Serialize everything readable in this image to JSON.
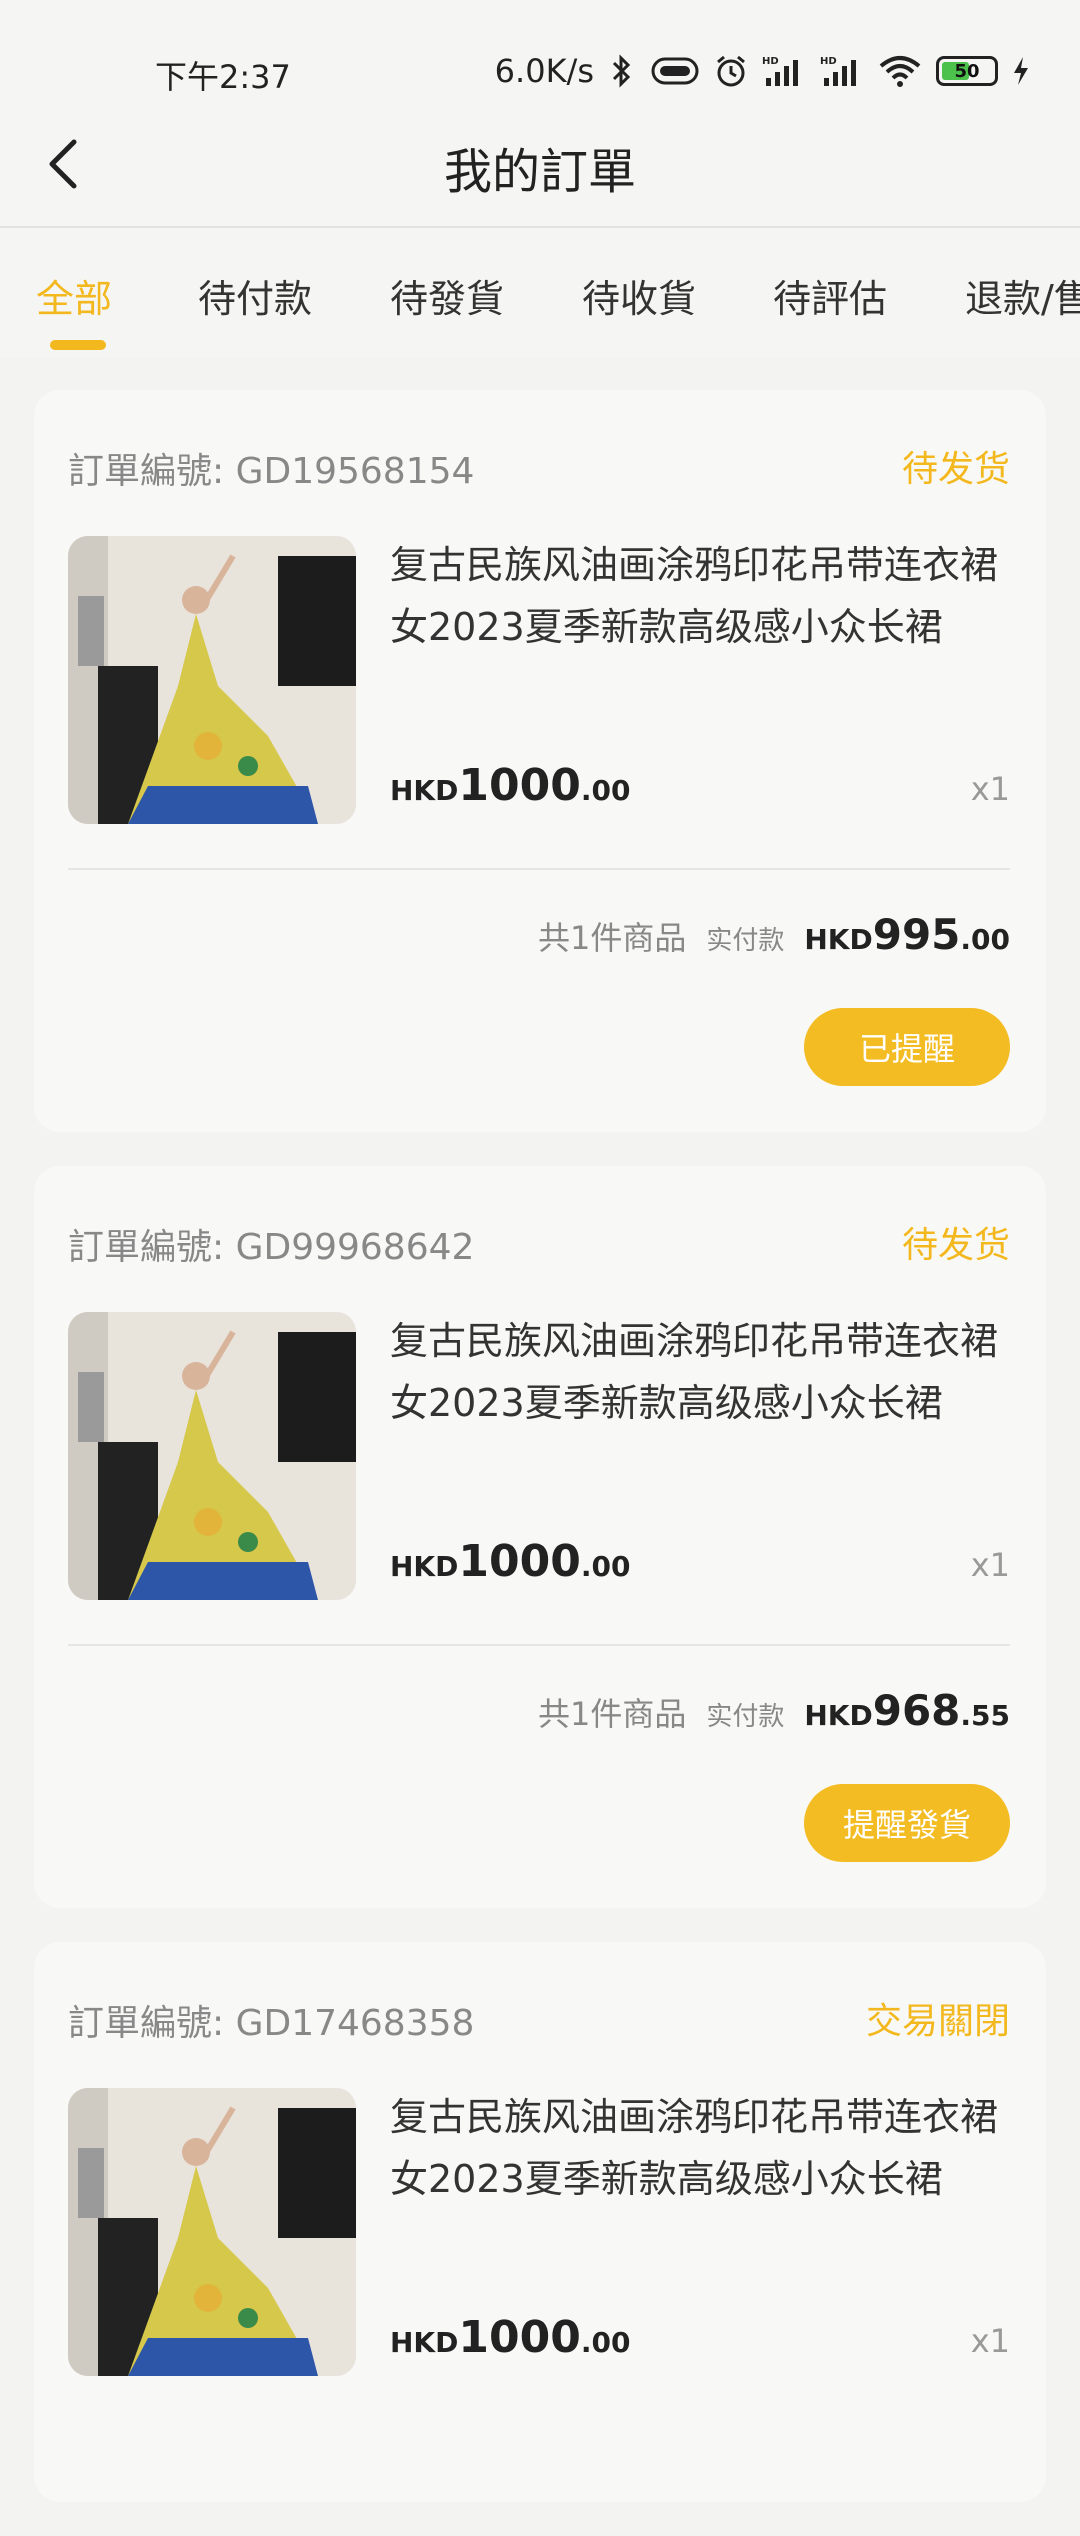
{
  "status_bar": {
    "time": "下午2:37",
    "net_speed": "6.0K/s",
    "battery": "50"
  },
  "header": {
    "title": "我的訂單"
  },
  "tabs": [
    {
      "label": "全部",
      "active": true
    },
    {
      "label": "待付款",
      "active": false
    },
    {
      "label": "待發貨",
      "active": false
    },
    {
      "label": "待收貨",
      "active": false
    },
    {
      "label": "待評估",
      "active": false
    },
    {
      "label": "退款/售",
      "active": false
    }
  ],
  "colors": {
    "accent": "#f3b81e",
    "button": "#f3bc22"
  },
  "orders": [
    {
      "order_no_label": "訂單編號:  GD19568154",
      "status": "待发货",
      "product_title": "复古民族风油画涂鸦印花吊带连衣裙女2023夏季新款高级感小众长裙",
      "price_currency": "HKD",
      "price_int": "1000",
      "price_dec": ".00",
      "qty": "x1",
      "count_text": "共1件商品",
      "paid_label": "实付款",
      "total_currency": "HKD",
      "total_int": "995",
      "total_dec": ".00",
      "action_label": "已提醒"
    },
    {
      "order_no_label": "訂單編號:  GD99968642",
      "status": "待发货",
      "product_title": "复古民族风油画涂鸦印花吊带连衣裙女2023夏季新款高级感小众长裙",
      "price_currency": "HKD",
      "price_int": "1000",
      "price_dec": ".00",
      "qty": "x1",
      "count_text": "共1件商品",
      "paid_label": "实付款",
      "total_currency": "HKD",
      "total_int": "968",
      "total_dec": ".55",
      "action_label": "提醒發貨"
    },
    {
      "order_no_label": "訂單編號:  GD17468358",
      "status": "交易關閉",
      "product_title": "复古民族风油画涂鸦印花吊带连衣裙女2023夏季新款高级感小众长裙",
      "price_currency": "HKD",
      "price_int": "1000",
      "price_dec": ".00",
      "qty": "x1"
    }
  ]
}
